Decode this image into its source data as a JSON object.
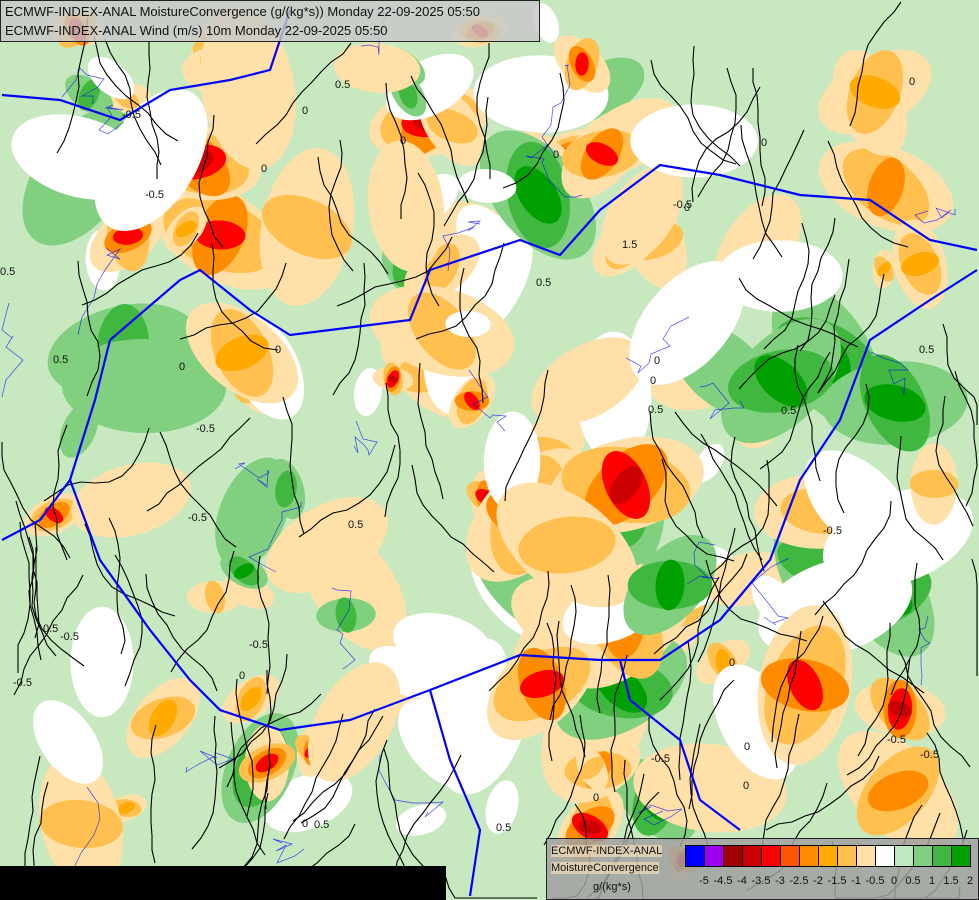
{
  "header": {
    "line1": "ECMWF-INDEX-ANAL MoistureConvergence (g/(kg*s)) Monday 22-09-2025 05:50",
    "line2": "ECMWF-INDEX-ANAL Wind (m/s) 10m Monday 22-09-2025 05:50"
  },
  "legend": {
    "title1": "ECMWF-INDEX-ANAL",
    "title2": "MoistureConvergence",
    "unit": "g/(kg*s)",
    "colors": [
      "#0000ff",
      "#a000f0",
      "#a00000",
      "#cc0000",
      "#ff0000",
      "#ff5500",
      "#ff8c00",
      "#ffaa00",
      "#ffc050",
      "#ffe0a8",
      "#ffffff",
      "#c0e8c0",
      "#80d080",
      "#40b840",
      "#00a000"
    ],
    "ticks": [
      "-5",
      "-4.5",
      "-4",
      "-3.5",
      "-3",
      "-2.5",
      "-2",
      "-1.5",
      "-1",
      "-0.5",
      "0",
      "0.5",
      "1",
      "1.5",
      "2"
    ]
  },
  "map": {
    "contour_labels": [
      "0",
      "0.5",
      "-0.5",
      "1.5"
    ],
    "border_color": "#0000ff",
    "streamline_color": "#000000"
  }
}
